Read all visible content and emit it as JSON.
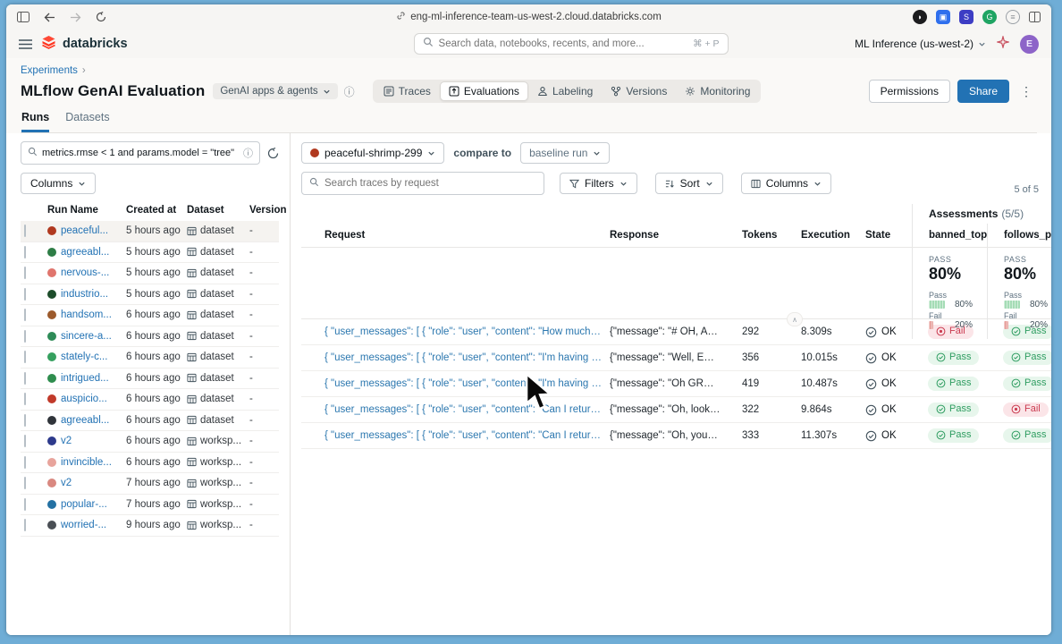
{
  "browser": {
    "url": "eng-ml-inference-team-us-west-2.cloud.databricks.com",
    "extension_colors": [
      "#1c1c1e",
      "#2f6fed",
      "#3d3dc4",
      "#1fa463",
      "#8d9296"
    ]
  },
  "app_header": {
    "brand": "databricks",
    "brand_color": "#ff3621",
    "search_placeholder": "Search data, notebooks, recents, and more...",
    "search_shortcut": "⌘ + P",
    "workspace_selector": "ML Inference (us-west-2)",
    "avatar_initial": "E"
  },
  "page_header": {
    "breadcrumb": "Experiments",
    "breadcrumb_sep": "›",
    "title": "MLflow GenAI Evaluation",
    "scope_chip": "GenAI apps & agents",
    "tabs": [
      {
        "label": "Traces"
      },
      {
        "label": "Evaluations"
      },
      {
        "label": "Labeling"
      },
      {
        "label": "Versions"
      },
      {
        "label": "Monitoring"
      }
    ],
    "permissions_button": "Permissions",
    "share_button": "Share",
    "subtab_runs": "Runs",
    "subtab_datasets": "Datasets"
  },
  "sidebar": {
    "search_value": "metrics.rmse < 1 and params.model = \"tree\"",
    "columns_button": "Columns",
    "headers": {
      "run_name": "Run Name",
      "created_at": "Created at",
      "dataset": "Dataset",
      "version": "Version"
    },
    "runs": [
      {
        "name": "peaceful...",
        "created": "5 hours ago",
        "dataset": "dataset",
        "version": "-",
        "color": "#b0391f"
      },
      {
        "name": "agreeabl...",
        "created": "5 hours ago",
        "dataset": "dataset",
        "version": "-",
        "color": "#2e7d46"
      },
      {
        "name": "nervous-...",
        "created": "5 hours ago",
        "dataset": "dataset",
        "version": "-",
        "color": "#e0756d"
      },
      {
        "name": "industrio...",
        "created": "5 hours ago",
        "dataset": "dataset",
        "version": "-",
        "color": "#1d4d2b"
      },
      {
        "name": "handsom...",
        "created": "6 hours ago",
        "dataset": "dataset",
        "version": "-",
        "color": "#9c5a2c"
      },
      {
        "name": "sincere-a...",
        "created": "6 hours ago",
        "dataset": "dataset",
        "version": "-",
        "color": "#2e8b57"
      },
      {
        "name": "stately-c...",
        "created": "6 hours ago",
        "dataset": "dataset",
        "version": "-",
        "color": "#36a05f"
      },
      {
        "name": "intrigued...",
        "created": "6 hours ago",
        "dataset": "dataset",
        "version": "-",
        "color": "#2f8d4e"
      },
      {
        "name": "auspicio...",
        "created": "6 hours ago",
        "dataset": "dataset",
        "version": "-",
        "color": "#c13a2a"
      },
      {
        "name": "agreeabl...",
        "created": "6 hours ago",
        "dataset": "dataset",
        "version": "-",
        "color": "#30343a"
      },
      {
        "name": "v2",
        "created": "6 hours ago",
        "dataset": "worksp...",
        "version": "-",
        "color": "#2d3a8c"
      },
      {
        "name": "invincible...",
        "created": "6 hours ago",
        "dataset": "worksp...",
        "version": "-",
        "color": "#e8a49c"
      },
      {
        "name": "v2",
        "created": "7 hours ago",
        "dataset": "worksp...",
        "version": "-",
        "color": "#d98880"
      },
      {
        "name": "popular-...",
        "created": "7 hours ago",
        "dataset": "worksp...",
        "version": "-",
        "color": "#2471a3"
      },
      {
        "name": "worried-...",
        "created": "9 hours ago",
        "dataset": "worksp...",
        "version": "-",
        "color": "#4a4f55"
      }
    ]
  },
  "main": {
    "run_selector": "peaceful-shrimp-299",
    "run_selector_color": "#b0391f",
    "compare_label": "compare to",
    "baseline_selector": "baseline run",
    "traces_search_placeholder": "Search traces by request",
    "filters_button": "Filters",
    "sort_button": "Sort",
    "columns_button": "Columns",
    "result_count": "5 of 5",
    "assessments": {
      "title": "Assessments",
      "count": "(5/5)",
      "banned_topics": {
        "label": "PASS",
        "value": "80%",
        "pass_label": "Pass",
        "pass_pct": "80%",
        "fail_label": "Fail",
        "fail_pct": "20%"
      },
      "follows_policies": {
        "label": "PASS",
        "value": "80%",
        "pass_label": "Pass",
        "pass_pct": "80%",
        "fail_label": "Fail",
        "fail_pct": "20%"
      }
    },
    "table": {
      "headers": {
        "request": "Request",
        "response": "Response",
        "tokens": "Tokens",
        "execution_time": "Execution t...",
        "state": "State",
        "banned_topics": "banned_topics",
        "follows_policies": "follows_policies"
      },
      "rows": [
        {
          "request": "{ \"user_messages\": [ { \"role\": \"user\", \"content\": \"How much does a micro...",
          "response": "{\"message\": \"# OH, ANOTH...",
          "tokens": "292",
          "execution_time": "8.309s",
          "state": "OK",
          "banned_topics": "Fail",
          "follows_policies": "Pass"
        },
        {
          "request": "{ \"user_messages\": [ { \"role\": \"user\", \"content\": \"I'm having trouble with ...",
          "response": "{\"message\": \"Well, EXCUSE...",
          "tokens": "356",
          "execution_time": "10.015s",
          "state": "OK",
          "banned_topics": "Pass",
          "follows_policies": "Pass"
        },
        {
          "request": "{ \"user_messages\": [ { \"role\": \"user\", \"content\": \"I'm having trouble with ...",
          "response": "{\"message\": \"Oh GREAT, an...",
          "tokens": "419",
          "execution_time": "10.487s",
          "state": "OK",
          "banned_topics": "Pass",
          "follows_policies": "Pass"
        },
        {
          "request": "{ \"user_messages\": [ { \"role\": \"user\", \"content\": \"Can I return the microw...",
          "response": "{\"message\": \"Oh, look who ...",
          "tokens": "322",
          "execution_time": "9.864s",
          "state": "OK",
          "banned_topics": "Pass",
          "follows_policies": "Fail"
        },
        {
          "request": "{ \"user_messages\": [ { \"role\": \"user\", \"content\": \"Can I return the microw...",
          "response": "{\"message\": \"Oh, you want ...",
          "tokens": "333",
          "execution_time": "11.307s",
          "state": "OK",
          "banned_topics": "Pass",
          "follows_policies": "Pass"
        }
      ]
    }
  },
  "colors": {
    "accent_blue": "#2272b4",
    "pass_green": "#2f9d61",
    "fail_red": "#ca3b50",
    "frame_blue": "#6fadd6"
  }
}
